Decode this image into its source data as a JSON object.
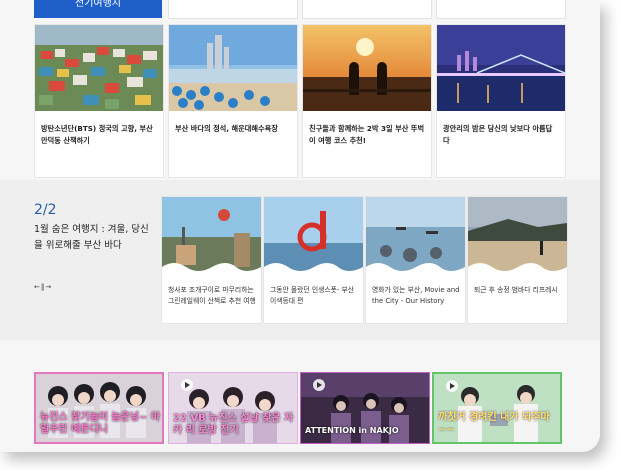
{
  "top": {
    "button_label": "전기여행지"
  },
  "cards": [
    {
      "title": "방탄소년단(BTS) 정국의 고향, 부산 만덕동 산책하기"
    },
    {
      "title": "부산 바다의 정석, 해운대해수욕장"
    },
    {
      "title": "친구들과 함께하는 2박 3일 부산 뚜벅이 여행 코스 추천!"
    },
    {
      "title": "광안리의 밤은 당신의 낮보다 아름답 다"
    }
  ],
  "section2": {
    "counter": "2/2",
    "heading": "1월 숨은 여행지 : 겨울, 당신을 위로해줄 부산 바다",
    "nav": "←‖→",
    "cards": [
      {
        "title": "청사포 조개구이로 마무리하는 그린레일웨이 산책로 추천 여행"
      },
      {
        "title": "그동안 몰랐던 인생스폿- 부산이색등대 편"
      },
      {
        "title": "영화가 있는 부산, Movie and the City - Our History"
      },
      {
        "title": "퇴근 후 송정 범바다 리프레시"
      }
    ]
  },
  "videos": [
    {
      "caption": "뉴진스 찾기놀이 놀은넝~ 아일우린 예튼디니"
    },
    {
      "caption": "22 VB 뉴진스 설날 찾은 자카 리 로방 전기"
    },
    {
      "caption": "ATTENTION in NAKJO"
    },
    {
      "caption": "까칫거 경려킨 내가 되주마~~"
    }
  ]
}
